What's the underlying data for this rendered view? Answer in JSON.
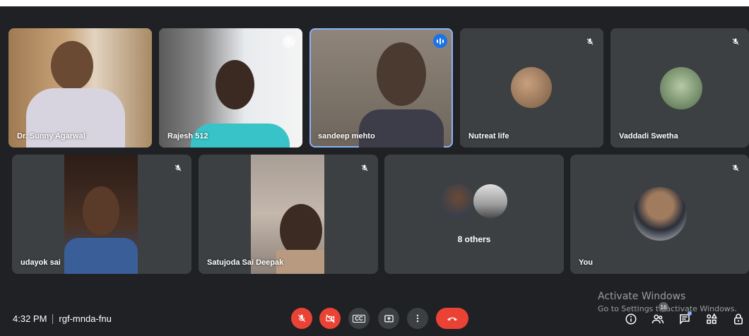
{
  "participants": [
    {
      "name": "Dr. Sunny Agarwal"
    },
    {
      "name": "Rajesh 512",
      "muted": true
    },
    {
      "name": "sandeep mehto",
      "speaking": true
    },
    {
      "name": "Nutreat life",
      "muted": true
    },
    {
      "name": "Vaddadi Swetha",
      "muted": true
    },
    {
      "name": "udayok sai",
      "muted": true
    },
    {
      "name": "Satujoda Sai Deepak",
      "muted": true
    },
    {
      "name": "8 others",
      "muted": true
    },
    {
      "name": "You",
      "muted": true
    }
  ],
  "meeting": {
    "time": "4:32 PM",
    "code": "rgf-mnda-fnu"
  },
  "controls": {
    "mic": "mic-off",
    "camera": "camera-off",
    "captions": "CC",
    "present": "present",
    "more": "more-options",
    "end": "end-call"
  },
  "right_panel": {
    "people_count": "16"
  },
  "watermark": {
    "line1": "Activate Windows",
    "line2": "Go to Settings to activate Windows."
  },
  "colors": {
    "background": "#202124",
    "tile": "#3c4043",
    "accent": "#1a73e8",
    "danger": "#ea4335"
  }
}
